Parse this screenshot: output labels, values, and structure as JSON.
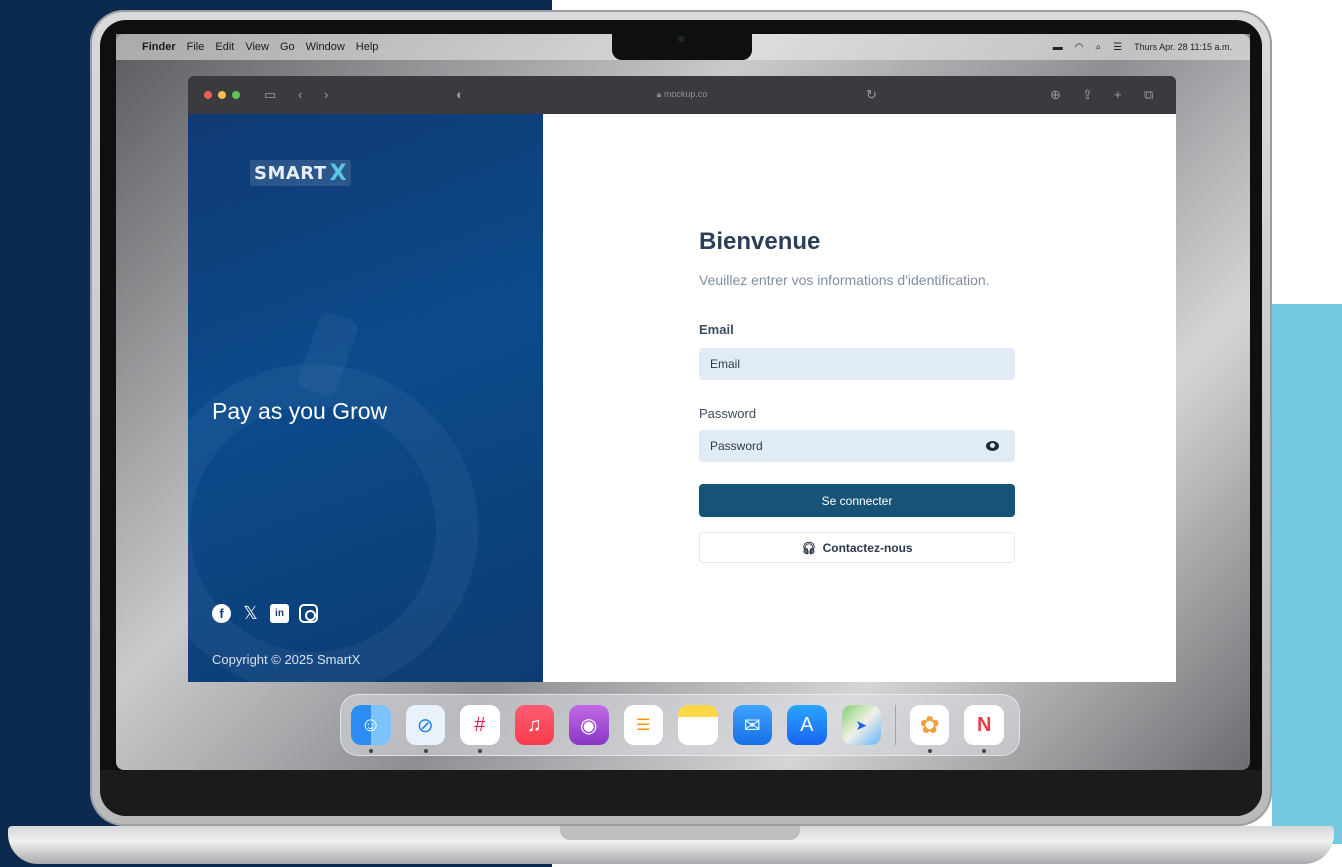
{
  "menubar": {
    "items": [
      "Finder",
      "File",
      "Edit",
      "View",
      "Go",
      "Window",
      "Help"
    ],
    "datetime": "Thurs Apr. 28 11:15 a.m."
  },
  "browser": {
    "url": "mockup.co"
  },
  "left_panel": {
    "logo_text": "SMART",
    "logo_mark": "X",
    "tagline": "Pay as you Grow",
    "socials": [
      "facebook-icon",
      "x-icon",
      "linkedin-icon",
      "instagram-icon"
    ],
    "copyright": "Copyright © 2025 SmartX"
  },
  "login": {
    "title": "Bienvenue",
    "subtitle": "Veuillez entrer vos informations d'identification.",
    "email_label": "Email",
    "email_placeholder": "Email",
    "password_label": "Password",
    "password_placeholder": "Password",
    "submit_label": "Se connecter",
    "contact_label": "Contactez-nous"
  },
  "dock": {
    "apps": [
      "Finder",
      "Safari",
      "Slack",
      "Music",
      "Podcasts",
      "Reminders",
      "Notes",
      "Mail",
      "App Store",
      "Maps",
      "Photos",
      "News"
    ]
  },
  "colors": {
    "background_navy": "#0b2a4e",
    "accent_cyan": "#73c9e0",
    "panel_blue": "#0c4a8b",
    "primary_button": "#175377",
    "input_fill": "#e1ebf6"
  }
}
